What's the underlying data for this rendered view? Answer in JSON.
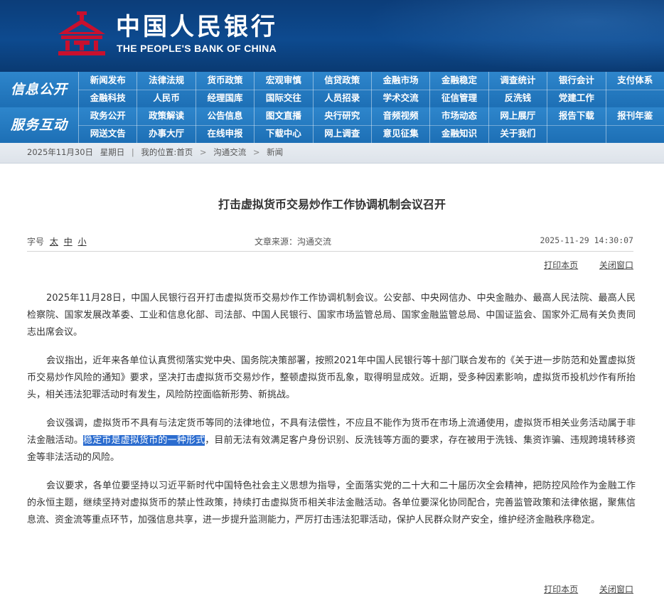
{
  "header": {
    "cn_name": "中国人民银行",
    "en_name": "THE PEOPLE'S BANK OF CHINA",
    "colors": {
      "banner": "#0d4a8f",
      "logo": "#c8102e"
    }
  },
  "nav": {
    "info_title": "信息公开",
    "service_title": "服务互动",
    "info_items": [
      "新闻发布",
      "法律法规",
      "货币政策",
      "宏观审慎",
      "信贷政策",
      "金融市场",
      "金融稳定",
      "调查统计",
      "银行会计",
      "支付体系",
      "金融科技",
      "人民币",
      "经理国库",
      "国际交往",
      "人员招录",
      "学术交流",
      "征信管理",
      "反洗钱",
      "党建工作",
      ""
    ],
    "service_items": [
      "政务公开",
      "政策解读",
      "公告信息",
      "图文直播",
      "央行研究",
      "音频视频",
      "市场动态",
      "网上展厅",
      "报告下载",
      "报刊年鉴",
      "网送文告",
      "办事大厅",
      "在线申报",
      "下载中心",
      "网上调查",
      "意见征集",
      "金融知识",
      "关于我们",
      "",
      ""
    ]
  },
  "breadcrumb": {
    "date": "2025年11月30日",
    "weekday": "星期日",
    "location_label": "我的位置:",
    "home": "首页",
    "level1": "沟通交流",
    "level2": "新闻"
  },
  "article": {
    "title": "打击虚拟货币交易炒作工作协调机制会议召开",
    "font_size_label": "字号",
    "font_large": "太",
    "font_medium": "中",
    "font_small": "小",
    "source": "文章来源：沟通交流",
    "datetime": "2025-11-29 14:30:07",
    "print": "打印本页",
    "close": "关闭窗口",
    "p1": "2025年11月28日，中国人民银行召开打击虚拟货币交易炒作工作协调机制会议。公安部、中央网信办、中央金融办、最高人民法院、最高人民检察院、国家发展改革委、工业和信息化部、司法部、中国人民银行、国家市场监管总局、国家金融监管总局、中国证监会、国家外汇局有关负责同志出席会议。",
    "p2": "会议指出，近年来各单位认真贯彻落实党中央、国务院决策部署，按照2021年中国人民银行等十部门联合发布的《关于进一步防范和处置虚拟货币交易炒作风险的通知》要求，坚决打击虚拟货币交易炒作，整顿虚拟货币乱象，取得明显成效。近期，受多种因素影响，虚拟货币投机炒作有所抬头，相关违法犯罪活动时有发生，风险防控面临新形势、新挑战。",
    "p3a": "会议强调，虚拟货币不具有与法定货币等同的法律地位，不具有法偿性，不应且不能作为货币在市场上流通使用，虚拟货币相关业务活动属于非法金融活动。",
    "p3_highlight": "稳定币是虚拟货币的一种形式",
    "p3b": "，目前无法有效满足客户身份识别、反洗钱等方面的要求，存在被用于洗钱、集资诈骗、违规跨境转移资金等非法活动的风险。",
    "p4": "会议要求，各单位要坚持以习近平新时代中国特色社会主义思想为指导，全面落实党的二十大和二十届历次全会精神，把防控风险作为金融工作的永恒主题，继续坚持对虚拟货币的禁止性政策，持续打击虚拟货币相关非法金融活动。各单位要深化协同配合，完善监管政策和法律依据，聚焦信息流、资金流等重点环节，加强信息共享，进一步提升监测能力，严厉打击违法犯罪活动，保护人民群众财产安全，维护经济金融秩序稳定。"
  }
}
